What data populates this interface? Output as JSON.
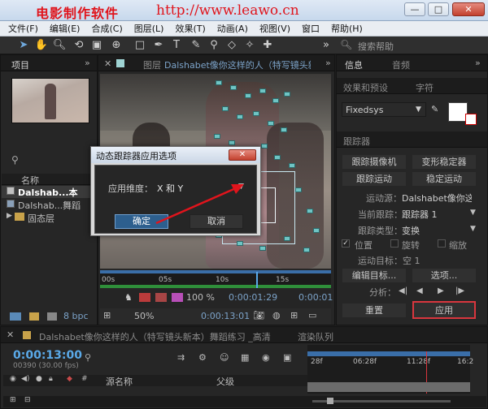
{
  "watermark": {
    "brand": "电影制作软件",
    "url": "http://www.leawo.cn"
  },
  "window_controls": {
    "minimize": "—",
    "maximize": "□",
    "close": "✕"
  },
  "menu": [
    "文件(F)",
    "编辑(E)",
    "合成(C)",
    "图层(L)",
    "效果(T)",
    "动画(A)",
    "视图(V)",
    "窗口",
    "帮助(H)"
  ],
  "toolbar": {
    "search_placeholder": "搜索帮助"
  },
  "project_panel": {
    "tab": "项目",
    "columns": {
      "name": "名称"
    },
    "items": [
      {
        "name": "Dalshab...本",
        "selected": true
      },
      {
        "name": "Dalshab...舞蹈"
      },
      {
        "name": "固态层"
      }
    ],
    "bpc": "8 bpc"
  },
  "composition_panel": {
    "tab_prefix": "图层",
    "tab_title": "Dalshabet像你这样的人（特写镜头新",
    "ruler": [
      "00s",
      "05s",
      "10s",
      "15s"
    ],
    "zoom": "50%",
    "timecode_1": "0:00:01:29",
    "timecode_2": "0:00:13:01",
    "timecode_3": "0:00:01",
    "percent": "100 %"
  },
  "info_panel": {
    "tabs": [
      "信息",
      "音频"
    ]
  },
  "effects_panel": {
    "tabs": [
      "效果和预设",
      "字符"
    ],
    "font": "Fixedsys"
  },
  "tracker_panel": {
    "title": "跟踪器",
    "buttons": [
      "跟踪摄像机",
      "变形稳定器",
      "跟踪运动",
      "稳定运动"
    ],
    "motion_source_label": "运动源：",
    "motion_source_value": "Dalshabet像你这",
    "current_track_label": "当前跟踪：",
    "current_track_value": "跟踪器 1",
    "track_type_label": "跟踪类型：",
    "track_type_value": "变换",
    "checkbox_position": "位置",
    "checkbox_rotation": "旋转",
    "checkbox_scale": "缩放",
    "motion_target": "运动目标：空 1",
    "edit_target": "编辑目标...",
    "options": "选项...",
    "analyze": "分析：",
    "reset": "重置",
    "apply": "应用"
  },
  "dialog": {
    "title": "动态跟踪器应用选项",
    "close": "✕",
    "dimension_label": "应用维度：",
    "dimension_value": "X 和 Y",
    "ok": "确定",
    "cancel": "取消"
  },
  "timeline": {
    "tab": "Dalshabet像你这样的人（特写镜头新本）舞蹈练习 _高清",
    "render_tab": "渲染队列",
    "timecode": "0:00:13:00",
    "frames": "00390 (30.00 fps)",
    "col_source": "源名称",
    "col_parent": "父级",
    "ticks": [
      "28f",
      "06:28f",
      "11:28f",
      "16:2"
    ]
  }
}
